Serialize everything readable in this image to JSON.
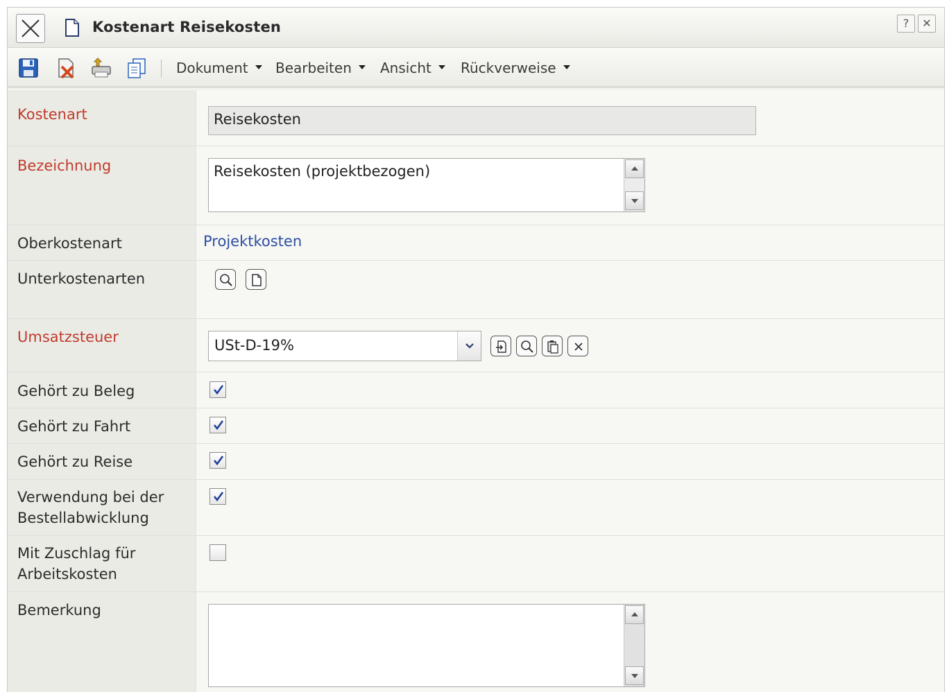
{
  "window": {
    "title": "Kostenart Reisekosten",
    "help_label": "?",
    "close_label": "✕"
  },
  "toolbar": {
    "icons": [
      "save-icon",
      "delete-icon",
      "print-icon",
      "copy-icon"
    ],
    "menus": [
      {
        "label": "Dokument"
      },
      {
        "label": "Bearbeiten"
      },
      {
        "label": "Ansicht"
      },
      {
        "label": "Rückverweise"
      }
    ]
  },
  "form": {
    "kostenart": {
      "label": "Kostenart",
      "value": "Reisekosten"
    },
    "bezeichnung": {
      "label": "Bezeichnung",
      "value": "Reisekosten (projektbezogen)"
    },
    "oberkostenart": {
      "label": "Oberkostenart",
      "value": "Projektkosten"
    },
    "unterkostenarten": {
      "label": "Unterkostenarten"
    },
    "umsatzsteuer": {
      "label": "Umsatzsteuer",
      "value": "USt-D-19%"
    },
    "gehoert_beleg": {
      "label": "Gehört zu Beleg",
      "checked": true
    },
    "gehoert_fahrt": {
      "label": "Gehört zu Fahrt",
      "checked": true
    },
    "gehoert_reise": {
      "label": "Gehört zu Reise",
      "checked": true
    },
    "verwendung": {
      "label_line1": "Verwendung bei der",
      "label_line2": "Bestellabwicklung",
      "checked": true
    },
    "zuschlag": {
      "label_line1": "Mit Zuschlag für",
      "label_line2": "Arbeitskosten",
      "checked": false
    },
    "bemerkung": {
      "label": "Bemerkung",
      "value": ""
    }
  },
  "colors": {
    "required_label": "#bf3b2b",
    "link": "#2d4fa3",
    "label_bg": "#ebebe6",
    "value_bg": "#f7f7f3"
  }
}
